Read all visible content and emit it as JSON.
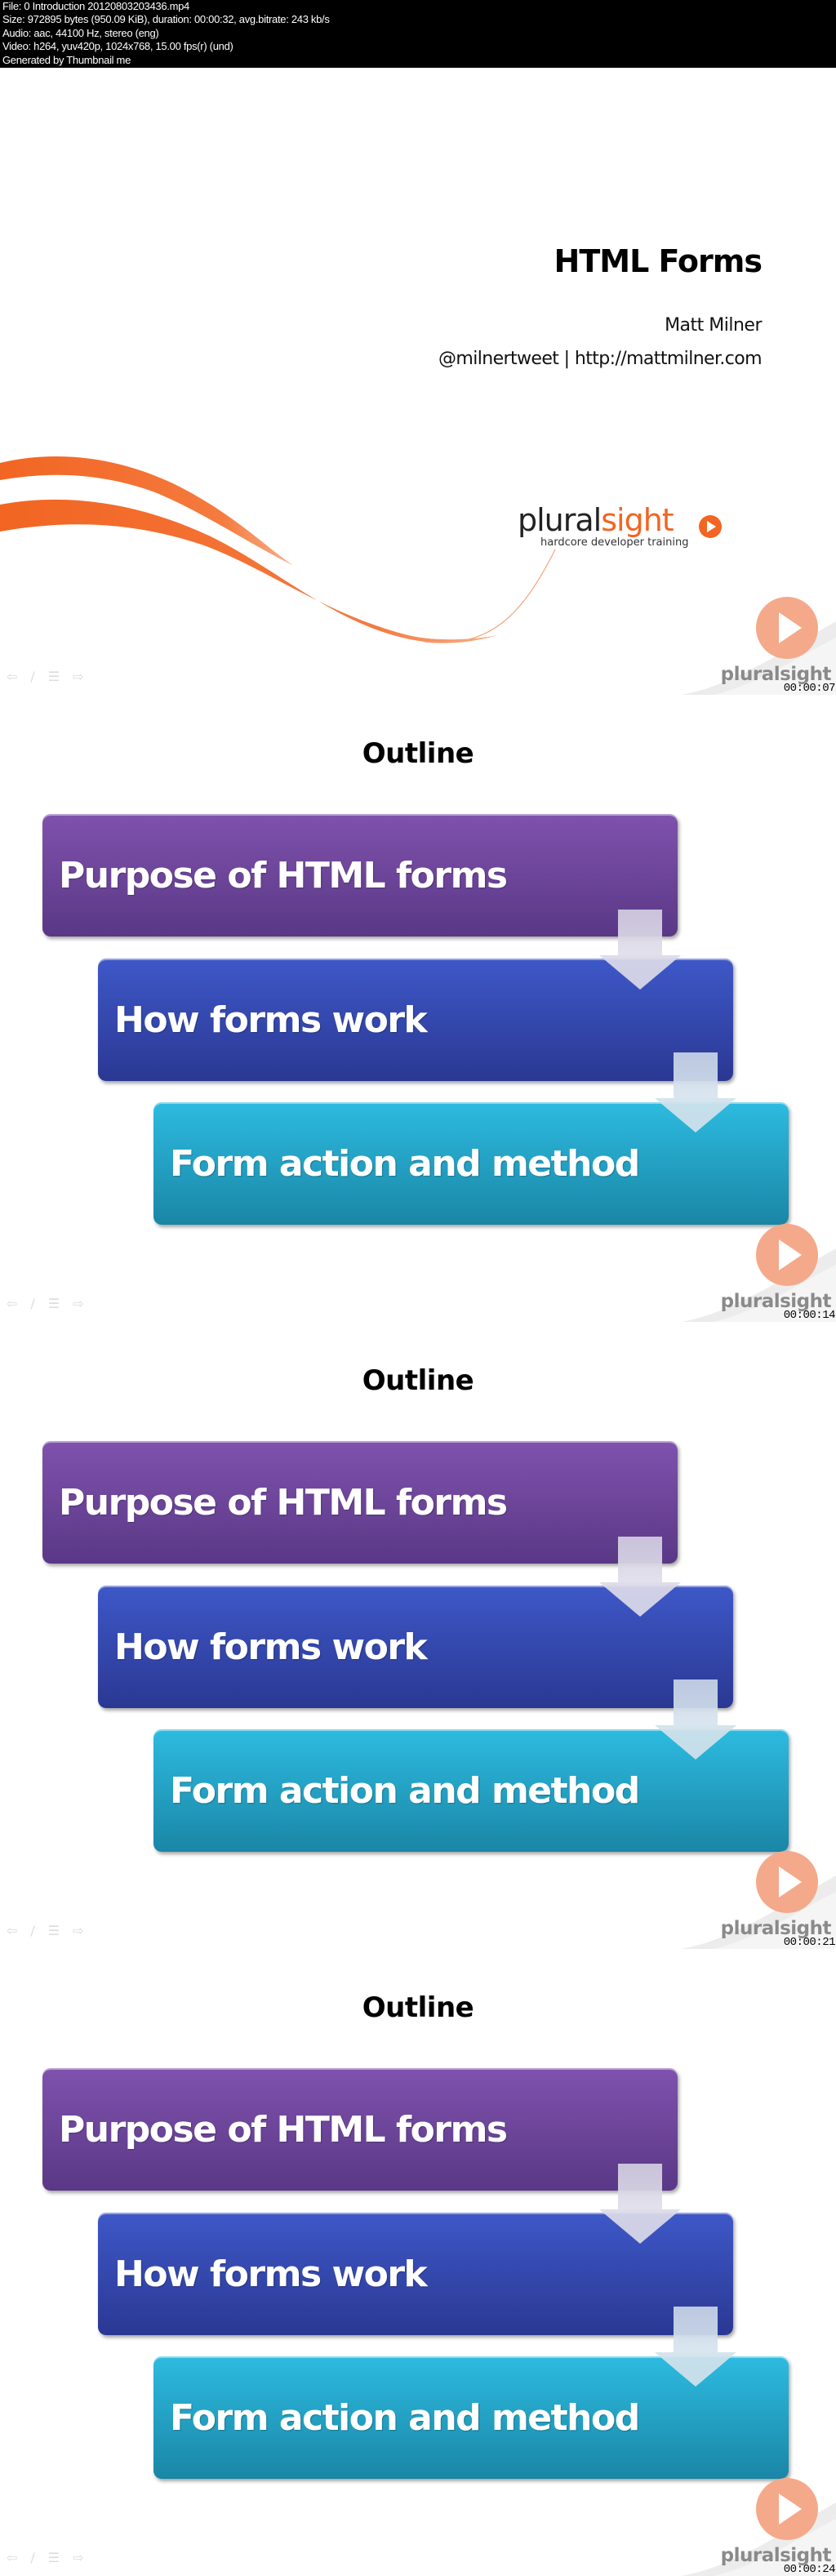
{
  "meta_header": {
    "lines": [
      "File: 0 Introduction 20120803203436.mp4",
      "Size: 972895 bytes (950.09 KiB), duration: 00:00:32, avg.bitrate: 243 kb/s",
      "Audio: aac, 44100 Hz, stereo (eng)",
      "Video: h264, yuv420p, 1024x768, 15.00 fps(r) (und)",
      "Generated by Thumbnail me"
    ]
  },
  "title_slide": {
    "title": "HTML Forms",
    "author": "Matt Milner",
    "contact": "@milnertweet | http://mattmilner.com",
    "logo": {
      "word_plural": "plural",
      "word_sight": "sight",
      "tagline": "hardcore developer training"
    },
    "timestamp": "00:00:07"
  },
  "outline_slides": [
    {
      "title": "Outline",
      "items": [
        "Purpose of HTML forms",
        "How forms work",
        "Form action and method"
      ],
      "timestamp": "00:00:14"
    },
    {
      "title": "Outline",
      "items": [
        "Purpose of HTML forms",
        "How forms work",
        "Form action and method"
      ],
      "timestamp": "00:00:21"
    },
    {
      "title": "Outline",
      "items": [
        "Purpose of HTML forms",
        "How forms work",
        "Form action and method"
      ],
      "timestamp": "00:00:24"
    }
  ],
  "branding": {
    "corner_brand": "pluralsight",
    "nav_icons": [
      "previous-arrow-icon",
      "pen-icon",
      "menu-icon",
      "next-arrow-icon"
    ],
    "colors": {
      "orange": "#f26522",
      "purple": "#7f52ad",
      "blue": "#3e58c8",
      "cyan": "#2dbbe0"
    }
  }
}
